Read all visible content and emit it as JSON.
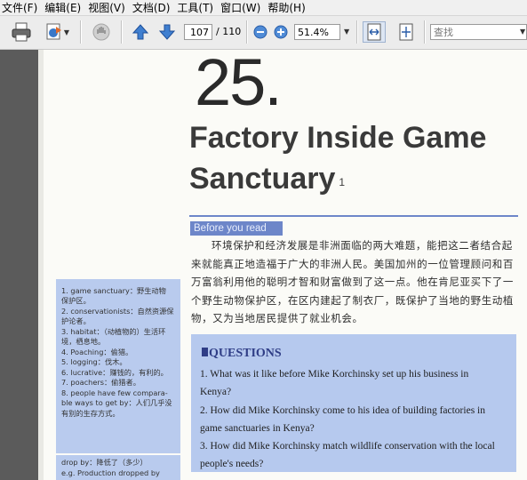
{
  "menu": [
    "文件(F)",
    "编辑(E)",
    "视图(V)",
    "文档(D)",
    "工具(T)",
    "窗口(W)",
    "帮助(H)"
  ],
  "toolbar": {
    "current_page": "107",
    "total_pages": "/ 110",
    "zoom": "51.4%",
    "search_placeholder": "查找",
    "icons": [
      "printer-icon",
      "export-icon",
      "hand-icon",
      "page-up-icon",
      "page-down-icon",
      "zoom-out-icon",
      "zoom-in-icon",
      "fit-width-icon",
      "fit-page-icon"
    ]
  },
  "document": {
    "chapter_number": "25.",
    "title_line1": "Factory Inside Game",
    "title_line2": "Sanctuary",
    "title_footnote": "1",
    "before_label": "Before you read",
    "before_text": "环境保护和经济发展是非洲面临的两大难题，能把这二者结合起来就能真正地造福于广大的非洲人民。美国加州的一位管理顾问和百万富翁利用他的聪明才智和财富做到了这一点。他在肯尼亚买下了一个野生动物保护区，在区内建起了制衣厂，既保护了当地的野生动植物，又为当地居民提供了就业机会。",
    "questions_heading": "QUESTIONS",
    "questions": [
      "1.  What was it like before Mike Korchinsky set up his business in",
      "Kenya?",
      "2.  How did Mike Korchinsky come to his idea of building factories in",
      "game sanctuaries in Kenya?",
      "3.  How did Mike Korchinsky match wildlife conservation with the local",
      "people's needs?"
    ],
    "glossary": [
      "1. game sanctuary：野生动物",
      "保护区。",
      "2. conservationists：自然资源保",
      "护论者。",
      "3. habitat：（动植物的）生活环",
      "境，栖息地。",
      "4. Poaching：偷猎。",
      "5. logging：伐木。",
      "6. lucrative：赚钱的，有利的。",
      "7. poachers：偷猎者。",
      "8. people have few compara-",
      "ble ways to get by：人们几乎没",
      "有别的生存方式。"
    ],
    "glossary2": [
      "drop by：降低了（多少）",
      "e.g. Production dropped by"
    ]
  },
  "colors": {
    "accent_blue": "#6d86c9",
    "box_blue": "#b6c9ee",
    "heading_blue": "#2f3d86"
  }
}
